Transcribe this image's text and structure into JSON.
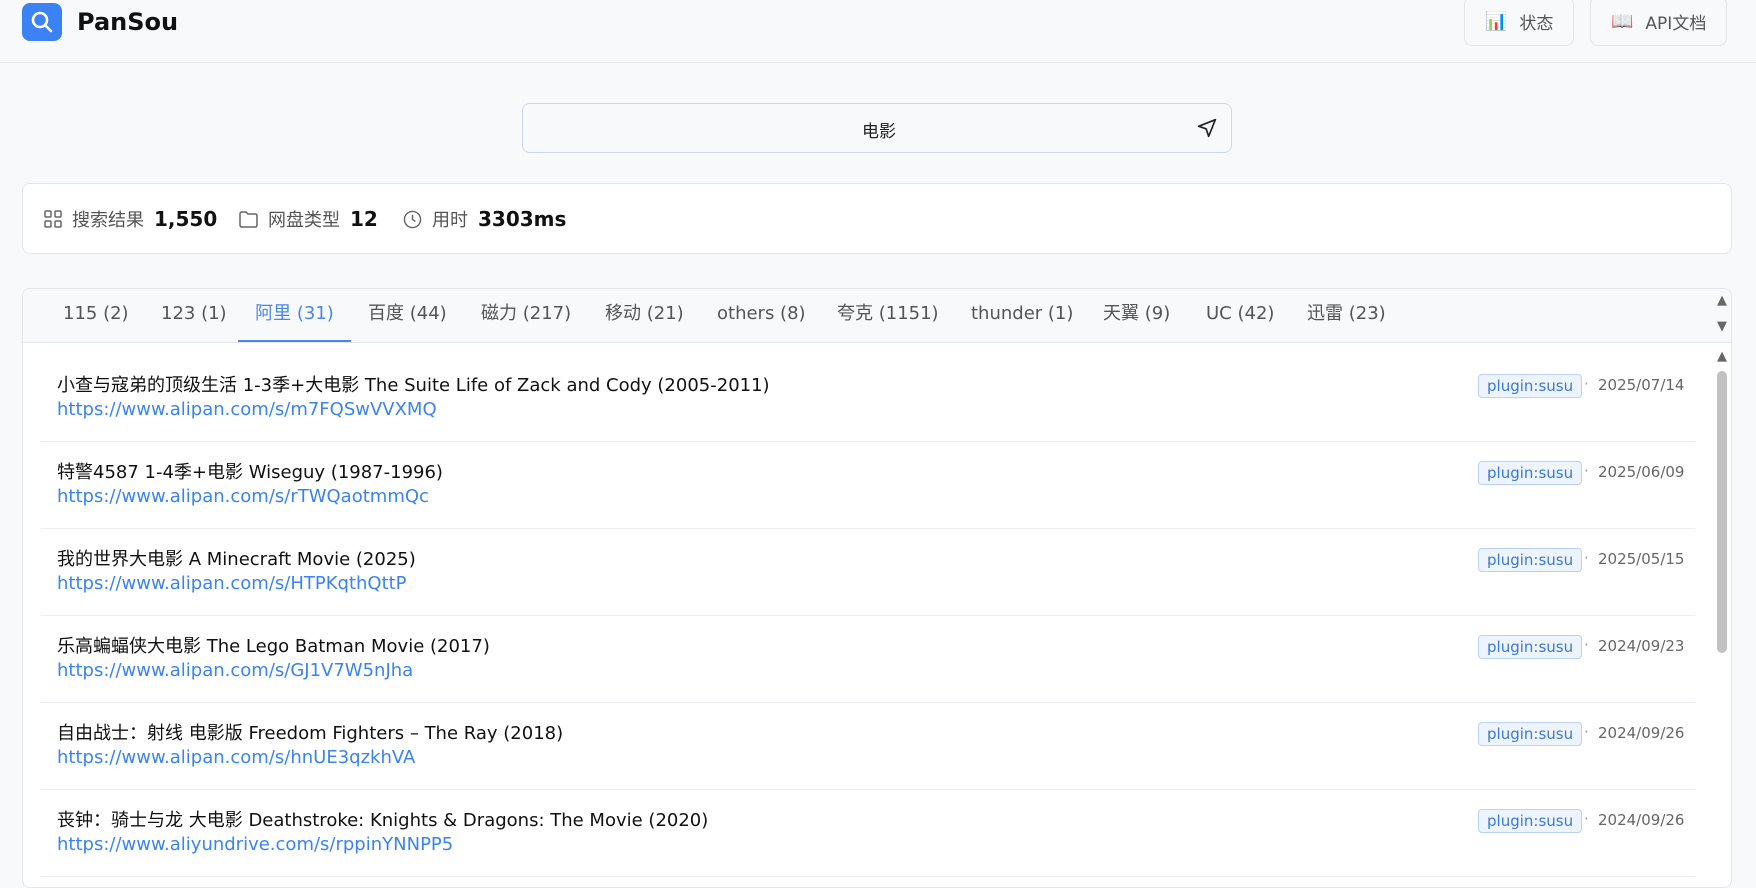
{
  "app": {
    "title": "PanSou"
  },
  "header": {
    "status_label": "状态",
    "api_label": "API文档",
    "status_icon": "bar-chart-icon",
    "api_icon": "book-icon"
  },
  "search": {
    "value": "电影"
  },
  "stats": {
    "results_label": "搜索结果",
    "results_value": "1,550",
    "types_label": "网盘类型",
    "types_value": "12",
    "time_label": "用时",
    "time_value": "3303ms"
  },
  "tabs": [
    {
      "label": "115 (2)"
    },
    {
      "label": "123 (1)"
    },
    {
      "label": "阿里 (31)"
    },
    {
      "label": "百度 (44)"
    },
    {
      "label": "磁力 (217)"
    },
    {
      "label": "移动 (21)"
    },
    {
      "label": "others (8)"
    },
    {
      "label": "夸克 (1151)"
    },
    {
      "label": "thunder (1)"
    },
    {
      "label": "天翼 (9)"
    },
    {
      "label": "UC (42)"
    },
    {
      "label": "迅雷 (23)"
    }
  ],
  "active_tab": "阿里 (31)",
  "results": [
    {
      "title": "小查与寇弟的顶级生活 1-3季+大电影 The Suite Life of Zack and Cody (2005-2011)",
      "url": "https://www.alipan.com/s/m7FQSwVVXMQ",
      "source": "plugin:susu",
      "date": "2025/07/14"
    },
    {
      "title": "特警4587 1-4季+电影 Wiseguy (1987-1996)",
      "url": "https://www.alipan.com/s/rTWQaotmmQc",
      "source": "plugin:susu",
      "date": "2025/06/09"
    },
    {
      "title": "我的世界大电影 A Minecraft Movie (2025)",
      "url": "https://www.alipan.com/s/HTPKqthQttP",
      "source": "plugin:susu",
      "date": "2025/05/15"
    },
    {
      "title": "乐高蝙蝠侠大电影 The Lego Batman Movie (2017)",
      "url": "https://www.alipan.com/s/GJ1V7W5nJha",
      "source": "plugin:susu",
      "date": "2024/09/23"
    },
    {
      "title": "自由战士：射线 电影版 Freedom Fighters – The Ray (2018)",
      "url": "https://www.alipan.com/s/hnUE3qzkhVA",
      "source": "plugin:susu",
      "date": "2024/09/26"
    },
    {
      "title": "丧钟：骑士与龙 大电影 Deathstroke: Knights & Dragons: The Movie (2020)",
      "url": "https://www.aliyundrive.com/s/rppinYNNPP5",
      "source": "plugin:susu",
      "date": "2024/09/26"
    }
  ],
  "colors": {
    "accent": "#3b82f6",
    "badge_bg": "#eef4fe",
    "badge_border": "#b9d2f5"
  }
}
